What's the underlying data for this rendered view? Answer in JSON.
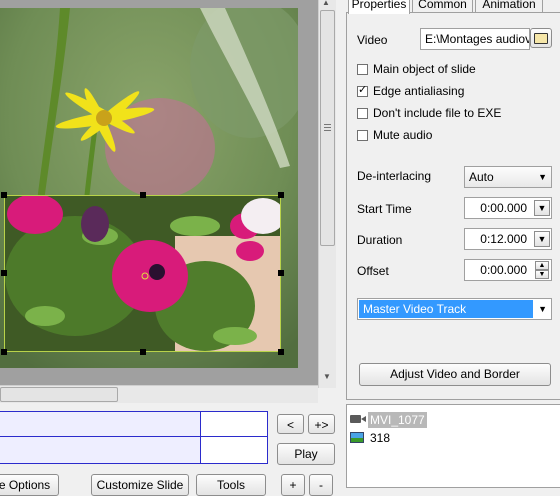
{
  "tabs": [
    "Properties",
    "Common",
    "Animation"
  ],
  "video": {
    "label": "Video",
    "path": "E:\\Montages audiov"
  },
  "checkboxes": [
    {
      "label": "Main object of slide",
      "checked": false
    },
    {
      "label": "Edge antialiasing",
      "checked": true
    },
    {
      "label": "Don't include file to EXE",
      "checked": false
    },
    {
      "label": "Mute audio",
      "checked": false
    }
  ],
  "deinterlacing": {
    "label": "De-interlacing",
    "value": "Auto"
  },
  "start_time": {
    "label": "Start Time",
    "value": "0:00.000"
  },
  "duration": {
    "label": "Duration",
    "value": "0:12.000"
  },
  "offset": {
    "label": "Offset",
    "value": "0:00.000"
  },
  "track": {
    "value": "Master Video Track"
  },
  "adjust_button": "Adjust Video and Border",
  "nav": {
    "prev": "<",
    "next": "+>",
    "play": "Play",
    "add": "+",
    "remove": "-"
  },
  "bottom_buttons": [
    "e Options",
    "Customize Slide",
    "Tools"
  ],
  "files": [
    {
      "name": "MVI_1077",
      "icon": "video-icon",
      "selected": true
    },
    {
      "name": "318",
      "icon": "image-icon",
      "selected": false
    }
  ],
  "colors": {
    "selection": "#3399ff",
    "timeline_border": "#2b2bcc",
    "flower": "#d81b7a"
  }
}
